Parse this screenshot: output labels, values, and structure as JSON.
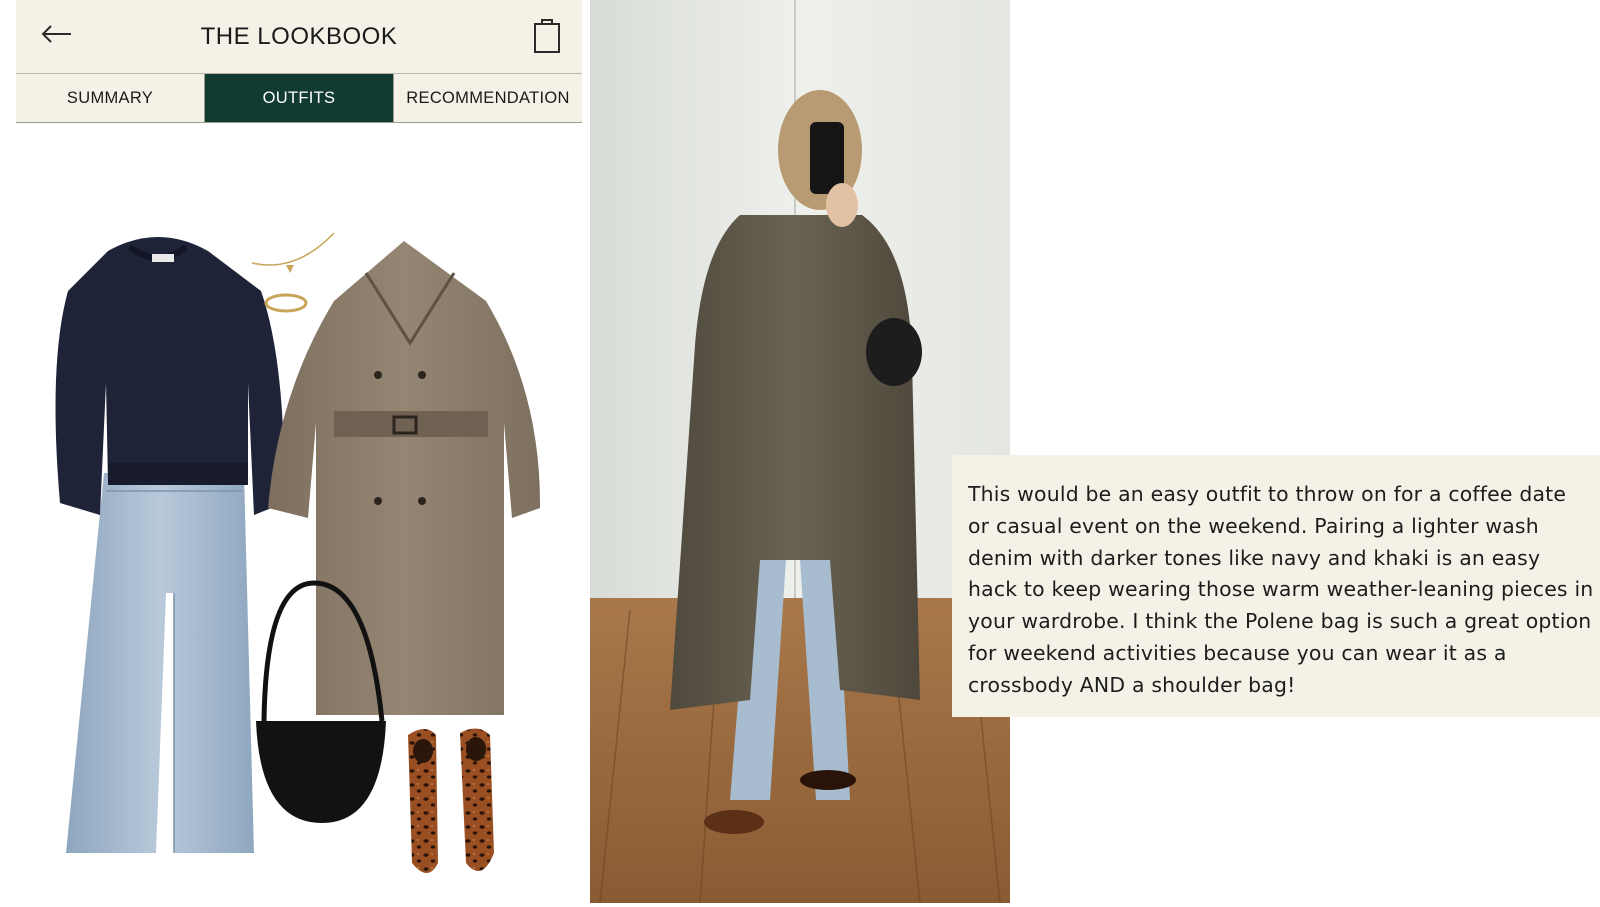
{
  "app": {
    "title": "THE LOOKBOOK",
    "back_icon": "arrow-left-icon",
    "cart_icon": "shopping-bag-icon",
    "tabs": [
      {
        "label": "SUMMARY",
        "active": false
      },
      {
        "label": "OUTFITS",
        "active": true
      },
      {
        "label": "RECOMMENDATION",
        "active": false
      }
    ],
    "colors": {
      "header_bg": "#f4f1e7",
      "active_tab_bg": "#113a31",
      "active_tab_text": "#ffffff"
    }
  },
  "collage": {
    "items": [
      "navy-sweater",
      "gold-necklace",
      "gold-ring",
      "khaki-trench-coat",
      "light-wash-jeans",
      "black-shoulder-bag",
      "leopard-flats"
    ]
  },
  "photo": {
    "subject": "mirror-selfie-trench-outfit"
  },
  "caption": {
    "text": "This would be an easy outfit to throw on for a coffee date or casual event on the weekend. Pairing a lighter wash denim with darker tones like navy and khaki is an easy hack to keep wearing those warm weather-leaning pieces in your wardrobe. I think the Polene bag is such a great option for weekend activities because you can wear it as a crossbody AND a shoulder bag!"
  }
}
